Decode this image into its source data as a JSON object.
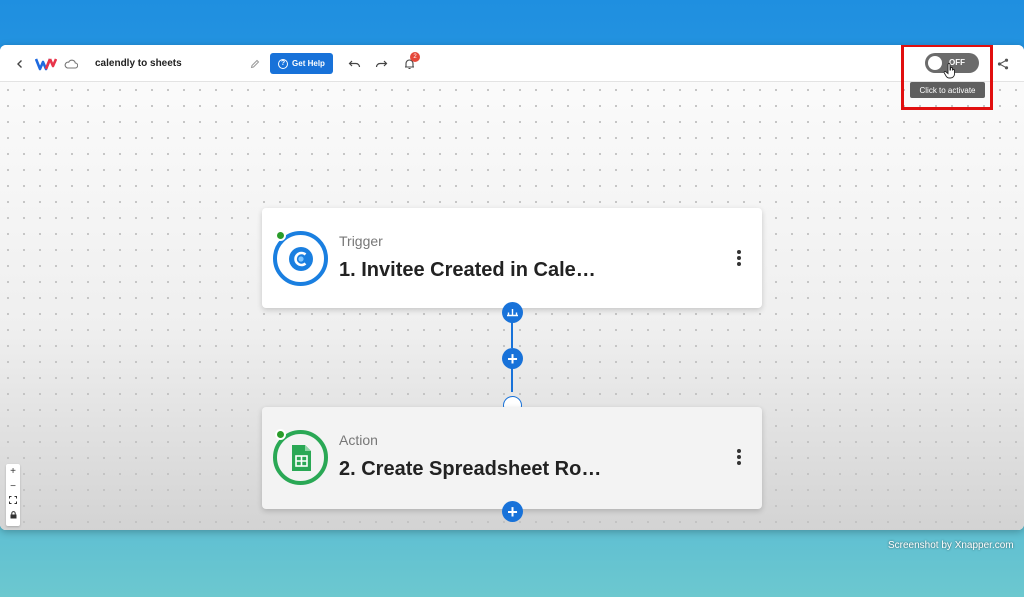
{
  "toolbar": {
    "workflow_name": "calendly to sheets",
    "help_label": "Get Help",
    "notification_count": "2"
  },
  "activation": {
    "toggle_label": "OFF",
    "tooltip": "Click to activate"
  },
  "steps": [
    {
      "type": "Trigger",
      "title": "1. Invitee Created in Cale…",
      "app": "calendly-icon"
    },
    {
      "type": "Action",
      "title": "2. Create Spreadsheet Ro…",
      "app": "google-sheets-icon"
    }
  ],
  "watermark": "Screenshot by Xnapper.com",
  "colors": {
    "accent": "#1872d9",
    "highlight": "#e10f0f",
    "trigger_ring": "#1a7fe0",
    "action_ring": "#2aa855",
    "status_active": "#2a9c2a"
  }
}
